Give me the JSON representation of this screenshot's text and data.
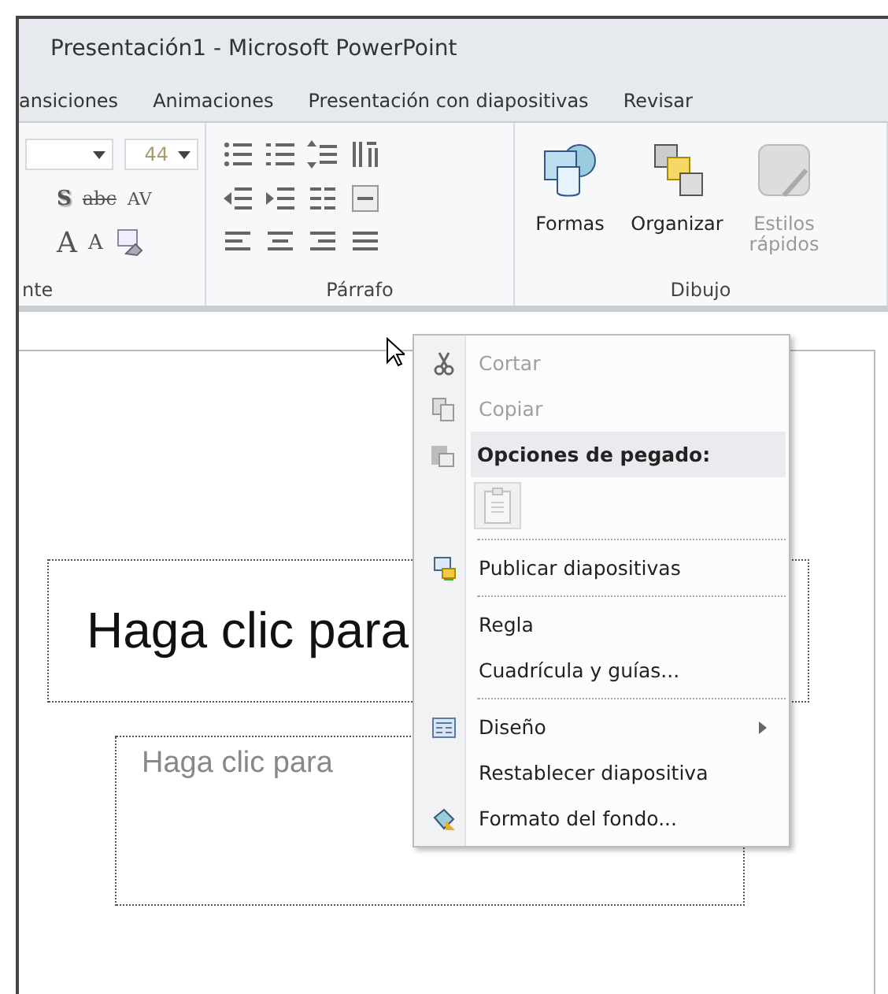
{
  "window": {
    "title": "Presentación1  -  Microsoft PowerPoint"
  },
  "tabs": [
    {
      "label": "ansiciones",
      "selected": false
    },
    {
      "label": "Animaciones",
      "selected": false
    },
    {
      "label": "Presentación con diapositivas",
      "selected": false
    },
    {
      "label": "Revisar",
      "selected": false
    }
  ],
  "ribbon": {
    "font_group": {
      "label": "nte",
      "size": "44",
      "buttons": [
        "S",
        "abc",
        "AV",
        "A",
        "A"
      ]
    },
    "paragraph_group": {
      "label": "Párrafo"
    },
    "drawing_group": {
      "label": "Dibujo",
      "buttons": [
        {
          "label": "Formas",
          "disabled": false
        },
        {
          "label": "Organizar",
          "disabled": false
        },
        {
          "label": "Estilos rápidos",
          "disabled": true
        }
      ]
    }
  },
  "slide": {
    "title_placeholder": "Haga clic para",
    "subtitle_placeholder": "Haga clic para"
  },
  "context_menu": {
    "items": [
      {
        "kind": "item",
        "label": "Cortar",
        "disabled": true,
        "submenu": false
      },
      {
        "kind": "item",
        "label": "Copiar",
        "disabled": true,
        "submenu": false
      },
      {
        "kind": "header",
        "label": "Opciones de pegado:"
      },
      {
        "kind": "paste",
        "disabled": true
      },
      {
        "kind": "separator"
      },
      {
        "kind": "item",
        "label": "Publicar diapositivas",
        "disabled": false,
        "submenu": false
      },
      {
        "kind": "separator"
      },
      {
        "kind": "item",
        "label": "Regla",
        "disabled": false,
        "submenu": false
      },
      {
        "kind": "item",
        "label": "Cuadrícula y guías...",
        "disabled": false,
        "submenu": false
      },
      {
        "kind": "separator"
      },
      {
        "kind": "item",
        "label": "Diseño",
        "disabled": false,
        "submenu": true
      },
      {
        "kind": "item",
        "label": "Restablecer diapositiva",
        "disabled": false,
        "submenu": false
      },
      {
        "kind": "item",
        "label": "Formato del fondo...",
        "disabled": false,
        "submenu": false
      }
    ]
  }
}
